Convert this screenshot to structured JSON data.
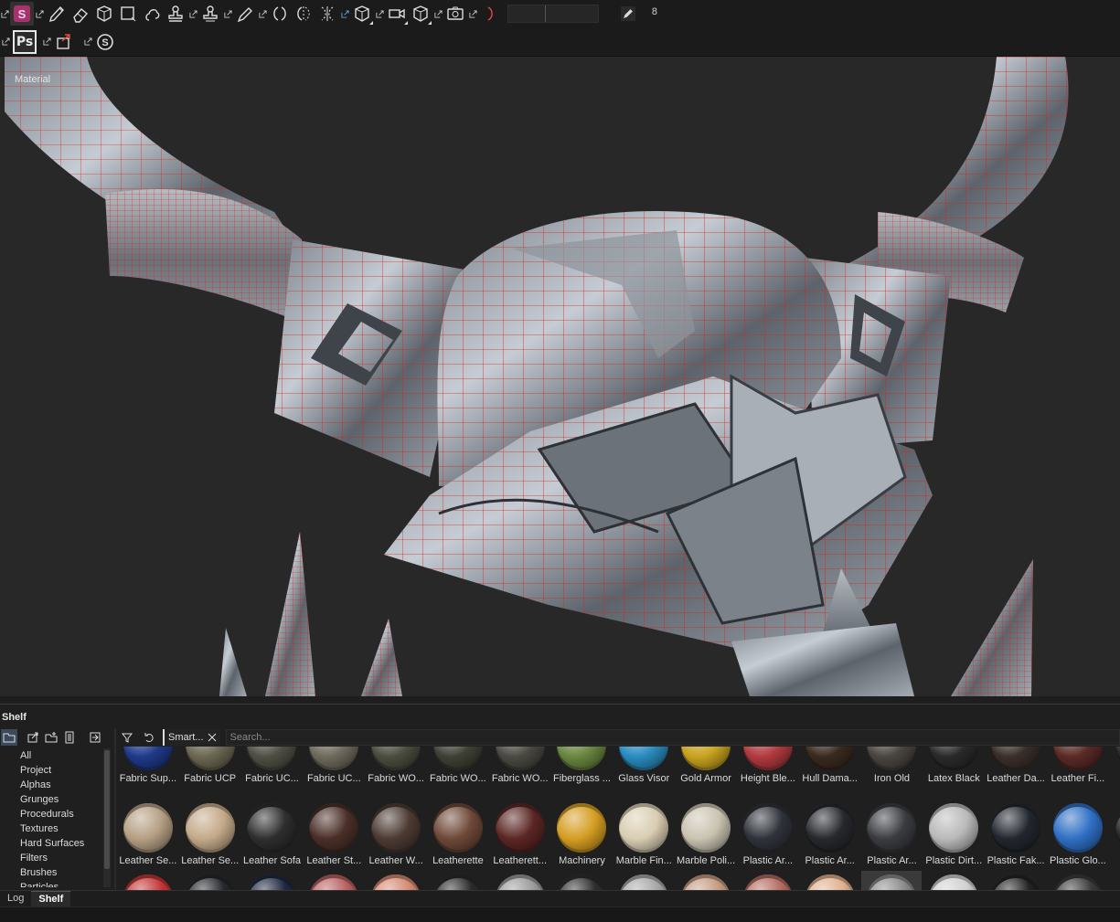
{
  "toolbar": {
    "brush_size_value": "8",
    "tools": [
      "painter-logo-icon",
      "brush-icon",
      "eraser-icon",
      "projection-icon",
      "polygon-fill-icon",
      "smudge-icon",
      "clone-icon",
      "material-picker-icon",
      "bake-icon",
      "symmetry-icon",
      "mirror-icon",
      "camera-icon",
      "viewport-box-icon",
      "render-icon",
      "screenshot-icon"
    ]
  },
  "toolbar2": {
    "ps_label": "Ps"
  },
  "viewport": {
    "mode_label": "Material",
    "wireframe_color": "#e0201c"
  },
  "shelf": {
    "title": "Shelf",
    "categories": [
      "All",
      "Project",
      "Alphas",
      "Grunges",
      "Procedurals",
      "Textures",
      "Hard Surfaces",
      "Filters",
      "Brushes",
      "Particles"
    ],
    "filter_chip": "Smart...",
    "search_placeholder": "Search...",
    "row1": [
      {
        "label": "Fabric Sup...",
        "color": "#1f3a8a"
      },
      {
        "label": "Fabric UCP",
        "color": "#6b6752"
      },
      {
        "label": "Fabric UC...",
        "color": "#4f4f45"
      },
      {
        "label": "Fabric UC...",
        "color": "#6e6a5c"
      },
      {
        "label": "Fabric WO...",
        "color": "#4b4d3e"
      },
      {
        "label": "Fabric WO...",
        "color": "#3f4035"
      },
      {
        "label": "Fabric WO...",
        "color": "#4a4a42"
      },
      {
        "label": "Fiberglass ...",
        "color": "#6a8640"
      },
      {
        "label": "Glass Visor",
        "color": "#2a8cc0"
      },
      {
        "label": "Gold Armor",
        "color": "#c7a21f"
      },
      {
        "label": "Height Ble...",
        "color": "#b13a3e"
      },
      {
        "label": "Hull Dama...",
        "color": "#3a2a1e"
      },
      {
        "label": "Iron Old",
        "color": "#4a4540"
      },
      {
        "label": "Latex Black",
        "color": "#2a2a2a"
      },
      {
        "label": "Leather Da...",
        "color": "#3a2f2a"
      },
      {
        "label": "Leather Fi...",
        "color": "#5a2a26"
      },
      {
        "label": "L",
        "color": "#2a2a2a"
      }
    ],
    "row2": [
      {
        "label": "Leather Se...",
        "color": "#b59f83"
      },
      {
        "label": "Leather Se...",
        "color": "#c4a98a"
      },
      {
        "label": "Leather Sofa",
        "color": "#2e2e2e"
      },
      {
        "label": "Leather St...",
        "color": "#4a2f28"
      },
      {
        "label": "Leather W...",
        "color": "#4c3a32"
      },
      {
        "label": "Leatherette",
        "color": "#6e4838"
      },
      {
        "label": "Leatherett...",
        "color": "#5a2624"
      },
      {
        "label": "Machinery",
        "color": "#d49d22"
      },
      {
        "label": "Marble Fin...",
        "color": "#d9cdb2"
      },
      {
        "label": "Marble Poli...",
        "color": "#c9c2b0"
      },
      {
        "label": "Plastic Ar...",
        "color": "#2f323a"
      },
      {
        "label": "Plastic Ar...",
        "color": "#26282c"
      },
      {
        "label": "Plastic Ar...",
        "color": "#3a3c40"
      },
      {
        "label": "Plastic Dirt...",
        "color": "#b9b9b9"
      },
      {
        "label": "Plastic Fak...",
        "color": "#22262e"
      },
      {
        "label": "Plastic Glo...",
        "color": "#2f6fc4"
      },
      {
        "label": "P",
        "color": "#2a2a2a"
      }
    ],
    "row3": [
      {
        "label": "",
        "color": "#c23636"
      },
      {
        "label": "",
        "color": "#25272b"
      },
      {
        "label": "",
        "color": "#1e2840"
      },
      {
        "label": "",
        "color": "#b86060"
      },
      {
        "label": "",
        "color": "#d48a72"
      },
      {
        "label": "",
        "color": "#2a2a2a"
      },
      {
        "label": "",
        "color": "#9a9a9a"
      },
      {
        "label": "",
        "color": "#2e2e2e"
      },
      {
        "label": "",
        "color": "#a8a8a8"
      },
      {
        "label": "",
        "color": "#c49a80"
      },
      {
        "label": "",
        "color": "#b26a60"
      },
      {
        "label": "",
        "color": "#e0b08e"
      },
      {
        "label": "",
        "color": "#8a8a8a"
      },
      {
        "label": "",
        "color": "#d0d0d0"
      },
      {
        "label": "",
        "color": "#222"
      },
      {
        "label": "",
        "color": "#3a3a3a"
      }
    ]
  },
  "bottom_tabs": [
    "Log",
    "Shelf"
  ]
}
